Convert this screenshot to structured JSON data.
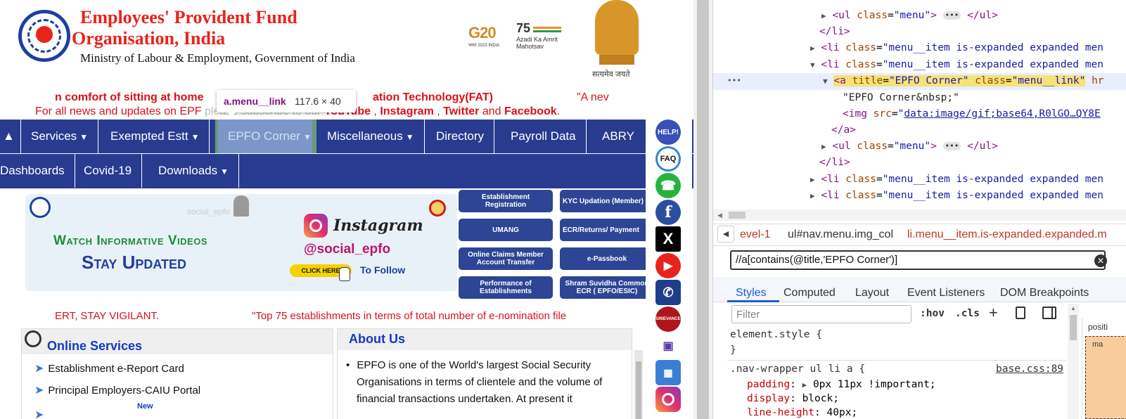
{
  "site": {
    "org_title_line1": "Employees' Provident Fund",
    "org_title_line2": "Organisation, India",
    "ministry": "Ministry of Labour & Employment, Government of India",
    "g20_label": "G20",
    "g20_sub": "भारत 2023 INDIA",
    "azadi_label": "Azadi Ka Amrit Mahotsav",
    "emblem_motto": "सत्यमेव जयते",
    "marquee_line1": "n comfort of sitting at home",
    "marquee_line1b": "ation Technology(FAT)",
    "marquee_line1c": "\"A nev",
    "news_prefix": "For all news and updates on EPF",
    "news_mid": "please subscribe to our",
    "news_youtube": "YouTube",
    "news_instagram": "Instagram",
    "news_twitter": "Twitter",
    "news_and": "and",
    "news_facebook": "Facebook",
    "tooltip_selector": "a.menu__link",
    "tooltip_size": "117.6 × 40",
    "nav_row1": [
      "Services",
      "Exempted Estt",
      "EPFO Corner",
      "Miscellaneous",
      "Directory",
      "Payroll Data",
      "ABRY"
    ],
    "nav_row2": [
      "Dashboards",
      "Covid-19",
      "Downloads"
    ],
    "banner": {
      "line1": "Watch Informative Videos",
      "line2": "Stay Updated",
      "insta": "Instagram",
      "handle": "@social_epfo",
      "click_here": "CLICK HERE",
      "to_follow": "To Follow",
      "faded_handle": "social_epfo"
    },
    "quick_links": [
      "Establishment Registration",
      "KYC Updation (Member)",
      "UMANG",
      "ECR/Returns/ Payment",
      "Online Claims Member Account Transfer",
      "e-Passbook",
      "Performance of Establishments",
      "Shram Suvidha Common ECR ( EPFO/ESIC)"
    ],
    "social_labels": {
      "help": "HELP!",
      "faq": "FAQ",
      "grievance": "GRIEVANCE"
    },
    "vigilant": "ERT, STAY VIGILANT.",
    "top75": "\"Top 75 establishments in terms of total number of e-nomination file",
    "online_services_title": "Online Services",
    "online_services": [
      "Establishment e-Report Card",
      "Principal Employers-CAIU Portal"
    ],
    "new_badge": "New",
    "about_title": "About Us",
    "about_text_l1": "EPFO is one of the World's largest Social Security",
    "about_text_l2": "Organisations in terms of clientele and the volume of",
    "about_text_l3": "financial transactions undertaken. At present it"
  },
  "devtools": {
    "dom_lines": {
      "l1_open": "<ul",
      "l1_attr": "class",
      "l1_val": "\"menu\"",
      "l1_close": "</ul>",
      "li_close": "</li>",
      "li_tag": "<li",
      "li_attr": "class",
      "li_val": "\"menu__item is-expanded expanded men",
      "a_tag": "<a",
      "a_title_attr": "title",
      "a_title_val": "\"EPFO Corner\"",
      "a_class_attr": "class",
      "a_class_val": "\"menu__link\"",
      "a_trunc": "hr",
      "text_node": "\"EPFO Corner&nbsp;\"",
      "img_tag": "<img",
      "img_attr": "src",
      "img_val": "data:image/gif;base64,R0lGO…QY8E",
      "a_close": "</a>",
      "dots_marker": "•••"
    },
    "breadcrumbs": [
      "evel-1",
      "ul#nav.menu.img_col",
      "li.menu__item.is-expanded.expanded.m"
    ],
    "search_value": "//a[contains(@title,'EPFO Corner')]",
    "tabs": [
      "Styles",
      "Computed",
      "Layout",
      "Event Listeners",
      "DOM Breakpoints"
    ],
    "filter_placeholder": "Filter",
    "hov": ":hov",
    "cls": ".cls",
    "rule1_selector": "element.style {",
    "rule1_close": "}",
    "rule2_selector": ".nav-wrapper ul li a {",
    "rule2_source": "base.css:89",
    "prop1_name": "padding",
    "prop1_value": "0px 11px !important;",
    "prop2_name": "display",
    "prop2_value": "block;",
    "prop3_name": "line-height",
    "prop3_value": "40px;",
    "side_label": "positi",
    "side_label2": "ma"
  },
  "colors": {
    "nav_bg": "#283b8f",
    "brand_red": "#e8231c",
    "highlight": "#f7e27a"
  }
}
